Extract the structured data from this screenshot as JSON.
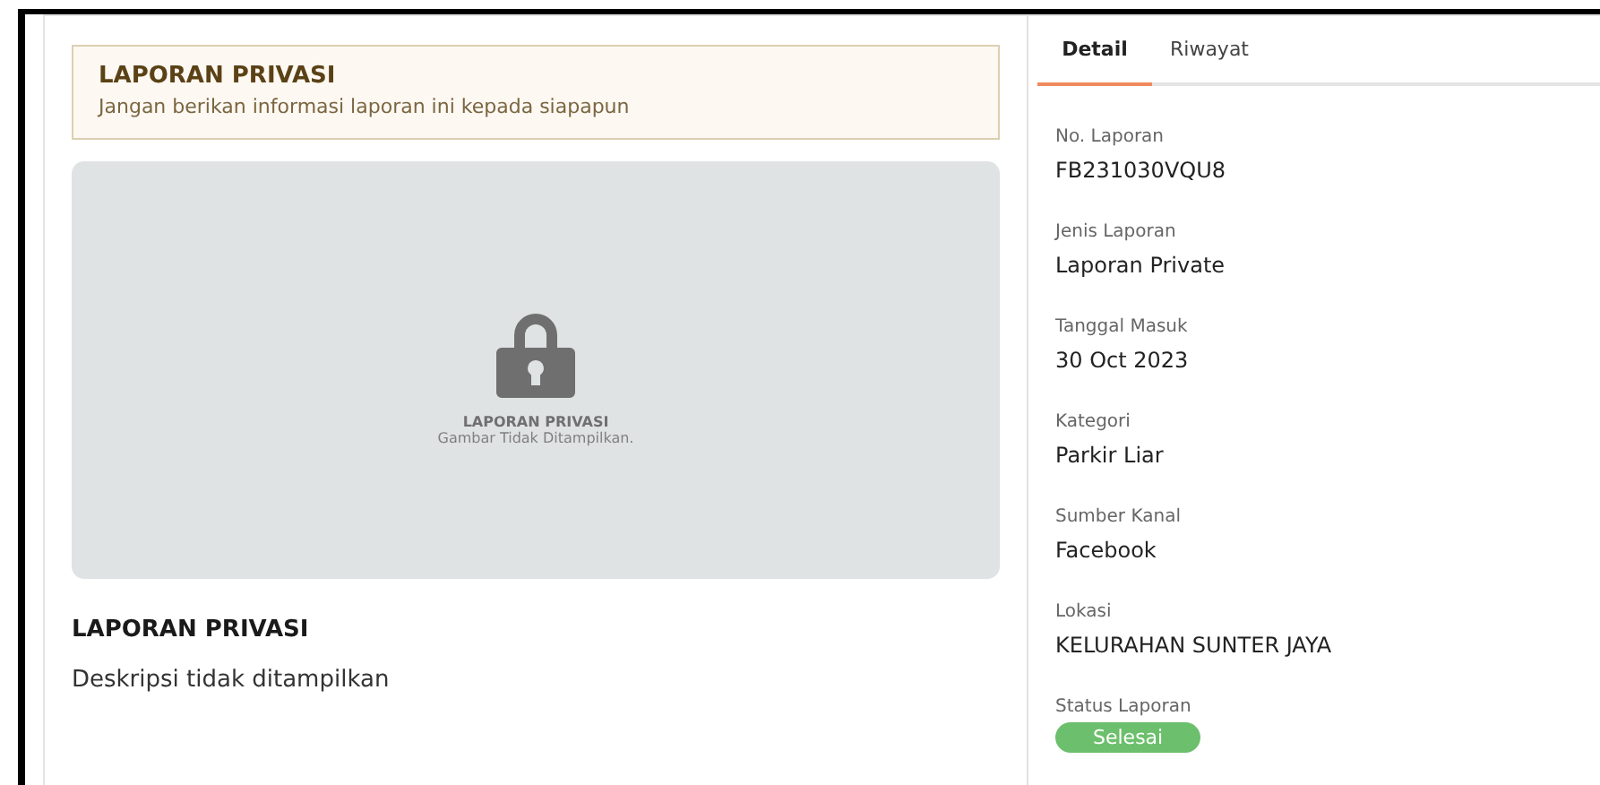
{
  "notice": {
    "title": "LAPORAN PRIVASI",
    "text": "Jangan berikan informasi laporan ini kepada siapapun"
  },
  "image_placeholder": {
    "title": "LAPORAN PRIVASI",
    "subtitle": "Gambar Tidak Ditampilkan."
  },
  "report": {
    "title": "LAPORAN PRIVASI",
    "description": "Deskripsi tidak ditampilkan"
  },
  "tabs": [
    {
      "label": "Detail",
      "selected": true
    },
    {
      "label": "Riwayat",
      "selected": false
    }
  ],
  "fields": [
    {
      "label": "No. Laporan",
      "value": "FB231030VQU8"
    },
    {
      "label": "Jenis Laporan",
      "value": "Laporan Private"
    },
    {
      "label": "Tanggal Masuk",
      "value": "30 Oct 2023"
    },
    {
      "label": "Kategori",
      "value": "Parkir Liar"
    },
    {
      "label": "Sumber Kanal",
      "value": "Facebook"
    },
    {
      "label": "Lokasi",
      "value": "KELURAHAN SUNTER JAYA"
    }
  ],
  "status": {
    "label": "Status Laporan",
    "value": "Selesai",
    "color": "#6cbf6c"
  }
}
